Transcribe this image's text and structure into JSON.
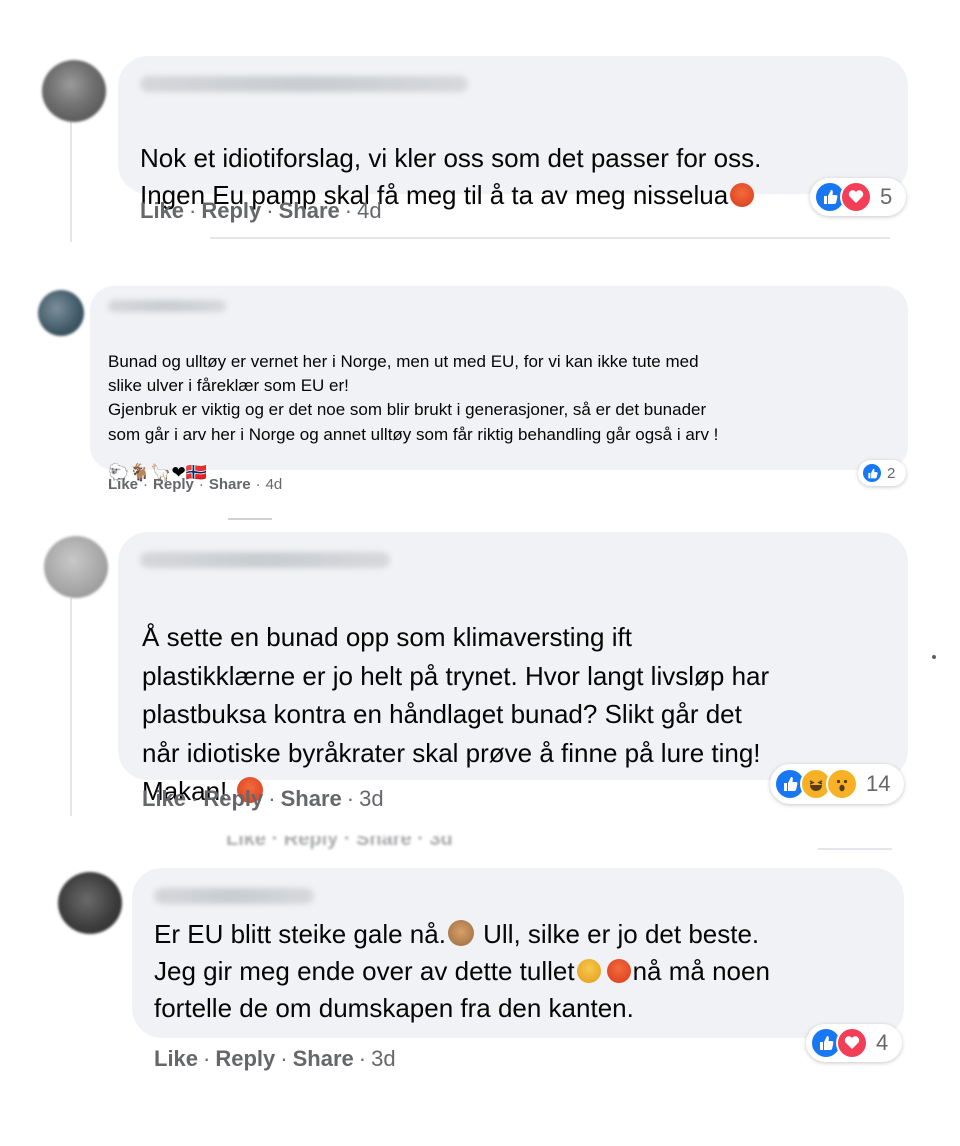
{
  "comments": [
    {
      "text": "Nok et idiotiforslag, vi kler oss som det passer for oss.\nIngen Eu pamp skal få meg til å ta av meg nisselua",
      "actions": {
        "like": "Like",
        "reply": "Reply",
        "share": "Share",
        "time": "4d"
      },
      "reactions": {
        "types": [
          "like",
          "love"
        ],
        "count": "5"
      }
    },
    {
      "text": "Bunad og ulltøy er vernet her i Norge, men ut med EU, for vi kan ikke tute med\nslike ulver i fåreklær som EU er!\nGjenbruk er viktig og er det noe som blir brukt i generasjoner, så er det bunader\nsom går i arv her i Norge og annet ulltøy som får riktig behandling går også i arv !",
      "emoji_line": "🐑🐐🦙❤🇳🇴",
      "actions": {
        "like": "Like",
        "reply": "Reply",
        "share": "Share",
        "time": "4d"
      },
      "reactions": {
        "types": [
          "like"
        ],
        "count": "2"
      }
    },
    {
      "text": "Å sette en bunad opp som klimaversting ift\nplastikklærne er jo helt på trynet. Hvor langt livsløp har\nplastbuksa kontra en håndlaget bunad? Slikt går det\nnår idiotiske byråkrater skal prøve å finne på lure ting!\nMakan!",
      "actions": {
        "like": "Like",
        "reply": "Reply",
        "share": "Share",
        "time": "3d"
      },
      "reactions": {
        "types": [
          "like",
          "haha",
          "wow"
        ],
        "count": "14"
      }
    },
    {
      "text_line1": "Er EU blitt steike gale nå.",
      "text_line1b": " Ull, silke er jo det beste.",
      "text_line2a": "Jeg gir meg ende over av dette tullet",
      "text_line2b": "nå må noen",
      "text_line3": "fortelle de om dumskapen fra den kanten.",
      "actions": {
        "like": "Like",
        "reply": "Reply",
        "share": "Share",
        "time": "3d"
      },
      "reactions": {
        "types": [
          "like",
          "love"
        ],
        "count": "4"
      }
    }
  ],
  "ghost_row": "Like · Reply · Share · 3d",
  "colors": {
    "bubble": "#f0f2f5",
    "meta": "#65676b",
    "like": "#1877f2",
    "love": "#f33e58",
    "haha": "#f7b125"
  },
  "icons": [
    "like-reaction-icon",
    "love-reaction-icon",
    "haha-reaction-icon",
    "wow-reaction-icon",
    "angry-emoji-icon",
    "see-no-evil-monkey-icon"
  ]
}
